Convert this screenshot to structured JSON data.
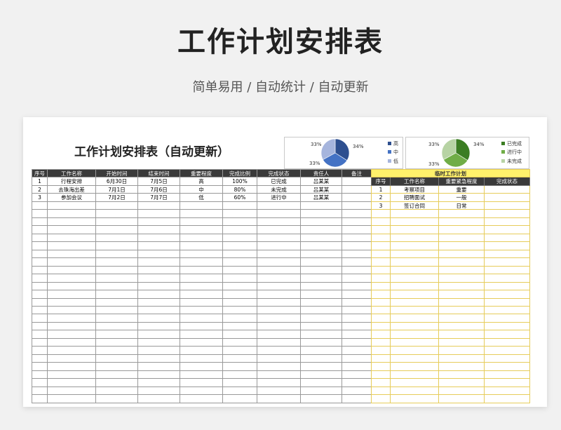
{
  "hero": {
    "title": "工作计划安排表",
    "subtitle": "简单易用 / 自动统计 / 自动更新"
  },
  "sheet_title": "工作计划安排表（自动更新）",
  "priority_chart": {
    "legend": [
      "高",
      "中",
      "低"
    ],
    "colors": [
      "#2e4f8f",
      "#4472c4",
      "#a6b5dd"
    ],
    "percent_labels": [
      "34%",
      "33%",
      "33%"
    ]
  },
  "status_chart": {
    "legend": [
      "已完成",
      "进行中",
      "未完成"
    ],
    "colors": [
      "#3b7d23",
      "#70ad47",
      "#b7d3a4"
    ],
    "percent_labels": [
      "34%",
      "33%",
      "33%"
    ]
  },
  "main_table": {
    "headers": [
      "序号",
      "工作名称",
      "开始时间",
      "结束时间",
      "重要程度",
      "完成比例",
      "完成状态",
      "责任人",
      "备注"
    ],
    "rows": [
      [
        "1",
        "行程安排",
        "6月30日",
        "7月5日",
        "高",
        "100%",
        "已完成",
        "吕某某",
        ""
      ],
      [
        "2",
        "去珠海出差",
        "7月1日",
        "7月6日",
        "中",
        "80%",
        "未完成",
        "吕某某",
        ""
      ],
      [
        "3",
        "参加会议",
        "7月2日",
        "7月7日",
        "低",
        "60%",
        "进行中",
        "吕某某",
        ""
      ]
    ]
  },
  "temp_table": {
    "title": "临时工作计划",
    "headers": [
      "序号",
      "工作名称",
      "重要紧急程度",
      "完成状态"
    ],
    "rows": [
      [
        "1",
        "考察项目",
        "重要",
        ""
      ],
      [
        "2",
        "招聘面试",
        "一般",
        ""
      ],
      [
        "3",
        "签订合同",
        "日常",
        ""
      ]
    ]
  }
}
